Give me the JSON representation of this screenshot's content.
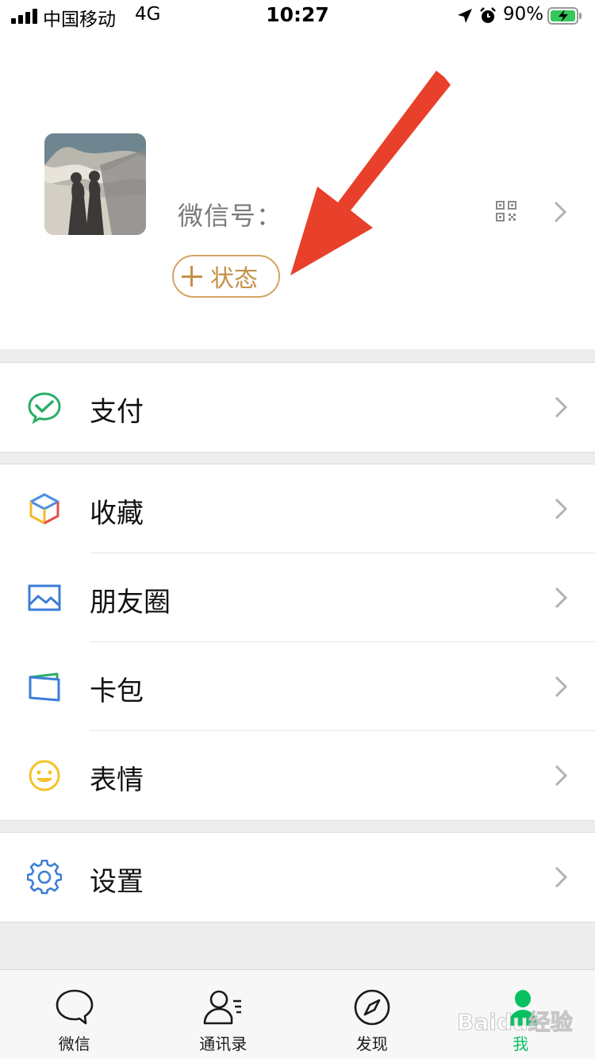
{
  "status_bar": {
    "carrier": "中国移动",
    "network": "4G",
    "time": "10:27",
    "battery": "90%"
  },
  "profile": {
    "wechat_id_label": "微信号：",
    "status_button": "状态"
  },
  "menu": {
    "pay": "支付",
    "favorites": "收藏",
    "moments": "朋友圈",
    "cards": "卡包",
    "stickers": "表情",
    "settings": "设置"
  },
  "tabs": [
    {
      "label": "微信",
      "icon": "chat-bubble-icon"
    },
    {
      "label": "通讯录",
      "icon": "contacts-icon"
    },
    {
      "label": "发现",
      "icon": "compass-icon"
    },
    {
      "label": "我",
      "icon": "me-person-icon",
      "active": true
    }
  ],
  "watermark": "Baidu经验",
  "colors": {
    "accent_green": "#07c160",
    "status_gold": "#c49149",
    "arrow_red": "#e8402a"
  }
}
